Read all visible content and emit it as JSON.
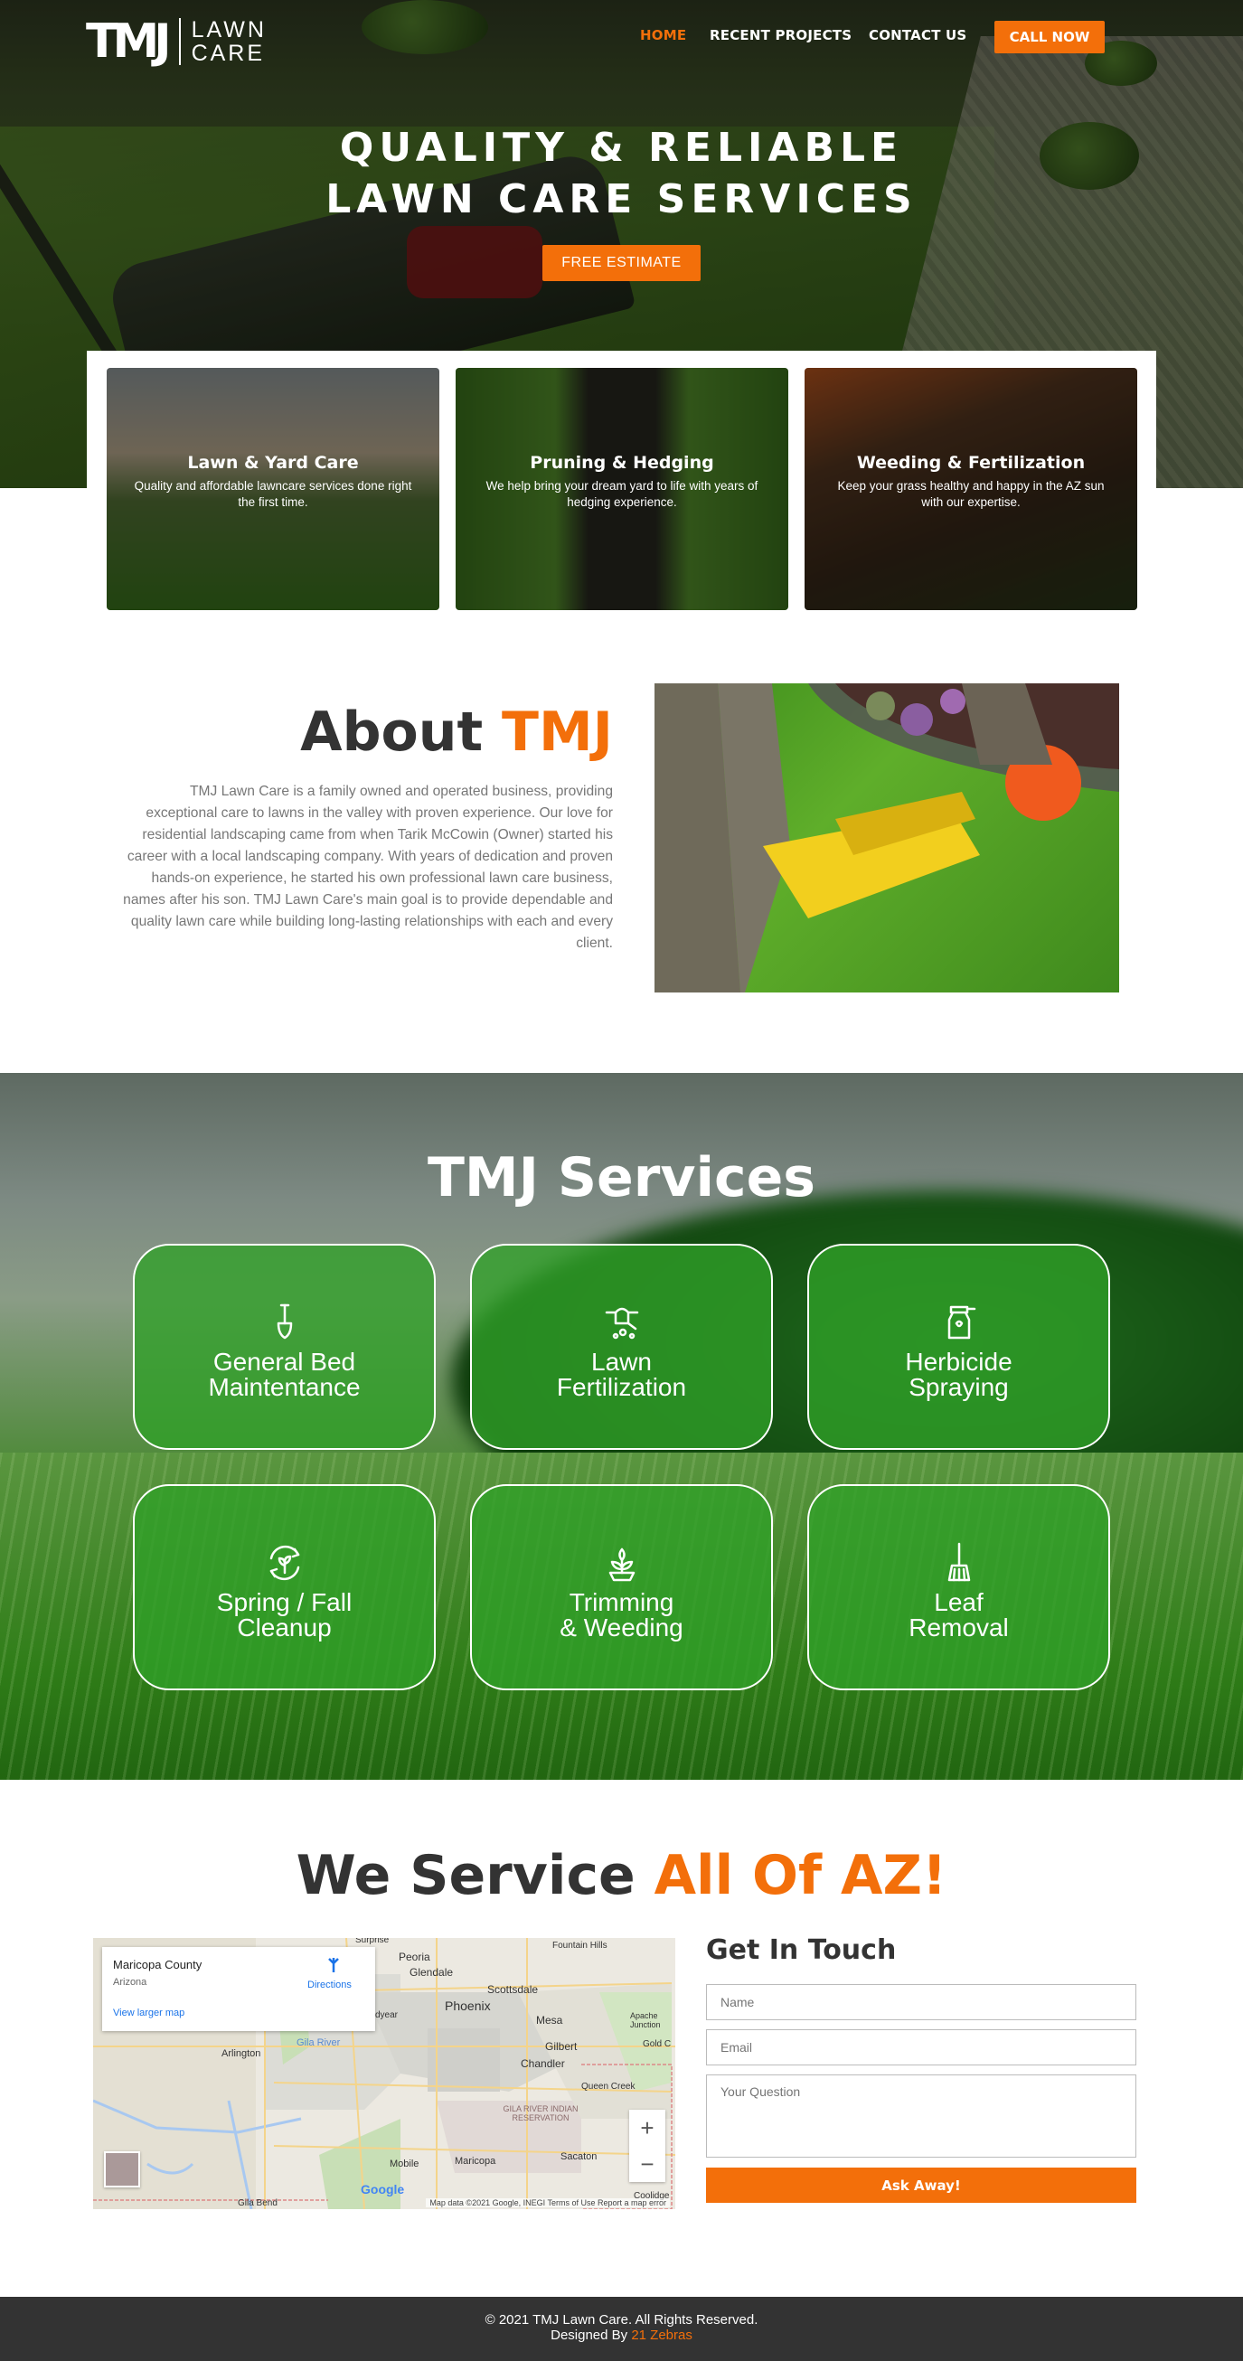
{
  "brand": {
    "logo_mark": "TMJ",
    "logo_line1": "LAWN",
    "logo_line2": "CARE",
    "accent_color": "#f36f0a"
  },
  "nav": {
    "items": [
      "HOME",
      "RECENT PROJECTS",
      "CONTACT US"
    ],
    "active": "HOME",
    "cta": "CALL NOW"
  },
  "hero": {
    "title_line1": "QUALITY & RELIABLE",
    "title_line2": "LAWN CARE SERVICES",
    "button": "FREE ESTIMATE"
  },
  "cards": [
    {
      "title": "Lawn & Yard Care",
      "text": "Quality and affordable lawncare services done right the first time."
    },
    {
      "title": "Pruning & Hedging",
      "text": "We help bring your dream yard to life with years of hedging experience."
    },
    {
      "title": "Weeding & Fertilization",
      "text": "Keep your grass healthy and happy in the AZ sun with our expertise."
    }
  ],
  "about": {
    "title_main": "About ",
    "title_accent": "TMJ",
    "text": "TMJ Lawn Care is a family owned and operated business, providing exceptional care to lawns in the valley with proven experience. Our love for residential landscaping came from when Tarik McCowin (Owner) started his career with a local landscaping company. With years of dedication and proven hands-on experience, he started his own professional lawn care business, names after his son. TMJ Lawn Care's main goal is to provide dependable and quality lawn care while building long-lasting relationships with each and every client."
  },
  "services": {
    "title": "TMJ Services",
    "items": [
      {
        "line1": "General Bed",
        "line2": "Maintentance",
        "icon": "shovel-icon"
      },
      {
        "line1": "Lawn",
        "line2": "Fertilization",
        "icon": "watering-can-icon"
      },
      {
        "line1": "Herbicide",
        "line2": "Spraying",
        "icon": "spray-bottle-icon"
      },
      {
        "line1": "Spring / Fall",
        "line2": "Cleanup",
        "icon": "recycle-plant-icon"
      },
      {
        "line1": "Trimming",
        "line2": "& Weeding",
        "icon": "sprout-icon"
      },
      {
        "line1": "Leaf",
        "line2": "Removal",
        "icon": "rake-icon"
      }
    ]
  },
  "service_area": {
    "title_main": "We Service ",
    "title_accent": "All Of AZ!"
  },
  "map": {
    "county": "Maricopa County",
    "state": "Arizona",
    "directions": "Directions",
    "larger": "View larger map",
    "places": [
      "Surprise",
      "Fountain Hills",
      "Peoria",
      "Glendale",
      "Scottsdale",
      "Phoenix",
      "Mesa",
      "Apache Junction",
      "Gilbert",
      "Gold C",
      "Chandler",
      "Arlington",
      "Gila River",
      "Queen Creek",
      "GILA RIVER INDIAN RESERVATION",
      "Sacaton",
      "Maricopa",
      "Mobile",
      "Coolidge",
      "Gila Bend",
      "dyear"
    ],
    "footer": "Map data ©2021 Google, INEGI   Terms of Use   Report a map error",
    "google": "Google"
  },
  "contact": {
    "title": "Get In Touch",
    "name_placeholder": "Name",
    "email_placeholder": "Email",
    "question_placeholder": "Your Question",
    "submit": "Ask Away!"
  },
  "footer": {
    "copyright": "© 2021 TMJ Lawn Care. All Rights Reserved.",
    "designed_by": "Designed By ",
    "designer": "21 Zebras"
  }
}
